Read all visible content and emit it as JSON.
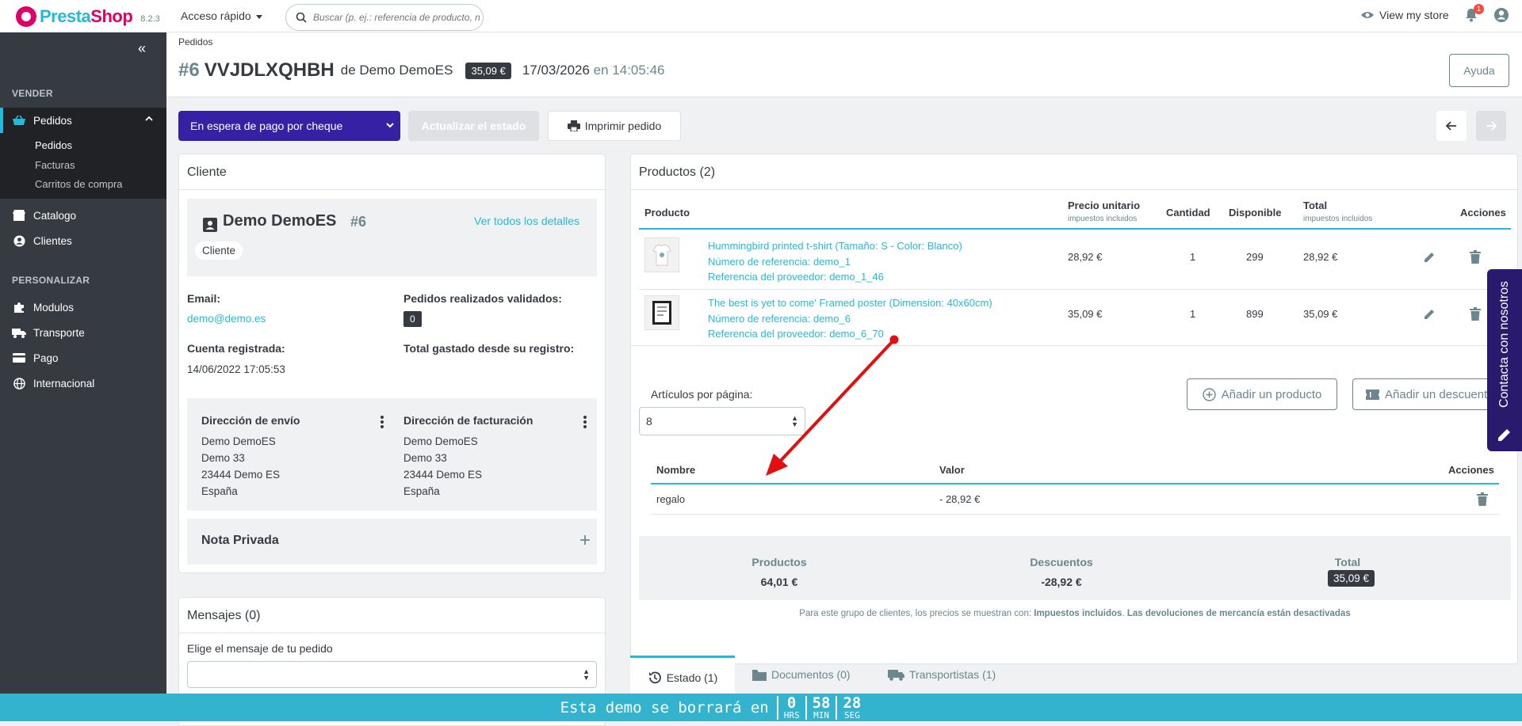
{
  "topbar": {
    "brand_a": "Presta",
    "brand_b": "Shop",
    "version": "8.2.3",
    "quick_access": "Acceso rápido",
    "search_placeholder": "Buscar (p. ej.: referencia de producto, nombre",
    "view_store": "View my store",
    "notifications_count": "1"
  },
  "sidebar": {
    "sections": [
      "VENDER",
      "PERSONALIZAR"
    ],
    "items": [
      {
        "label": "Pedidos",
        "icon": "basket-icon",
        "active": true
      },
      {
        "label": "Catalogo",
        "icon": "store-icon"
      },
      {
        "label": "Clientes",
        "icon": "user-circle-icon"
      },
      {
        "label": "Modulos",
        "icon": "puzzle-icon"
      },
      {
        "label": "Transporte",
        "icon": "truck-icon"
      },
      {
        "label": "Pago",
        "icon": "credit-card-icon"
      },
      {
        "label": "Internacional",
        "icon": "globe-icon"
      }
    ],
    "subitems": [
      "Pedidos",
      "Facturas",
      "Carritos de compra"
    ]
  },
  "header": {
    "breadcrumb": "Pedidos",
    "order_number": "#6",
    "reference": "VVJDLXQHBH",
    "customer_prefix": "de Demo DemoES",
    "total_pill": "35,09 €",
    "date": "17/03/2026",
    "time_prefix": "en 14:05:46",
    "help": "Ayuda"
  },
  "actions": {
    "status": "En espera de pago por cheque",
    "update": "Actualizar el estado",
    "print": "Imprimir pedido"
  },
  "customer": {
    "card_title": "Cliente",
    "name": "Demo DemoES",
    "id": "#6",
    "view_all": "Ver todos los detalles",
    "badge": "Cliente",
    "email_label": "Email:",
    "email": "demo@demo.es",
    "orders_label": "Pedidos realizados validados:",
    "orders_value": "0",
    "registered_label": "Cuenta registrada:",
    "registered_value": "14/06/2022 17:05:53",
    "spent_label": "Total gastado desde su registro:",
    "shipping_title": "Dirección de envío",
    "billing_title": "Dirección de facturación",
    "shipping_lines": [
      "Demo DemoES",
      "Demo 33",
      "23444 Demo ES",
      "España"
    ],
    "billing_lines": [
      "Demo DemoES",
      "Demo 33",
      "23444 Demo ES",
      "España"
    ],
    "private_note": "Nota Privada"
  },
  "messages": {
    "title": "Mensajes (0)",
    "choose_label": "Elige el mensaje de tu pedido"
  },
  "products": {
    "title": "Productos (2)",
    "headers": {
      "product": "Producto",
      "unit_price": "Precio unitario",
      "unit_price_sub": "impuestos incluidos",
      "qty": "Cantidad",
      "available": "Disponible",
      "total": "Total",
      "total_sub": "impuestos incluidos",
      "actions": "Acciones"
    },
    "rows": [
      {
        "name": "Hummingbird printed t-shirt (Tamaño: S - Color: Blanco)",
        "ref": "Número de referencia: demo_1",
        "supplier_ref": "Referencia del proveedor: demo_1_46",
        "price": "28,92 €",
        "qty": "1",
        "available": "299",
        "total": "28,92 €"
      },
      {
        "name": "The best is yet to come' Framed poster (Dimension: 40x60cm)",
        "ref": "Número de referencia: demo_6",
        "supplier_ref": "Referencia del proveedor: demo_6_70",
        "price": "35,09 €",
        "qty": "1",
        "available": "899",
        "total": "35,09 €"
      }
    ],
    "per_page_label": "Artículos por página:",
    "per_page_value": "8",
    "add_product": "Añadir un producto",
    "add_discount": "Añadir un descuento"
  },
  "discounts": {
    "headers": {
      "name": "Nombre",
      "value": "Valor",
      "actions": "Acciones"
    },
    "rows": [
      {
        "name": "regalo",
        "value": "- 28,92 €"
      }
    ]
  },
  "totals": {
    "products_label": "Productos",
    "products_value": "64,01 €",
    "discounts_label": "Descuentos",
    "discounts_value": "-28,92 €",
    "total_label": "Total",
    "total_value": "35,09 €",
    "note_a": "Para este grupo de clientes, los precios se muestran con: ",
    "note_b": "Impuestos incluidos",
    "note_c": ". ",
    "note_d": "Las devoluciones de mercancía están desactivadas"
  },
  "tabs": [
    "Estado (1)",
    "Documentos (0)",
    "Transportistas (1)"
  ],
  "contact_widget": "Contacta con nosotros",
  "demo_footer": {
    "message": "Esta demo se borrará en",
    "hours": "0",
    "hours_unit": "HRS",
    "minutes": "58",
    "minutes_unit": "MIN",
    "seconds": "28",
    "seconds_unit": "SEG"
  },
  "colors": {
    "accent": "#25b9d7",
    "status_bg": "#3621a4",
    "sidebar": "#363a41",
    "arrow": "#e01010"
  }
}
